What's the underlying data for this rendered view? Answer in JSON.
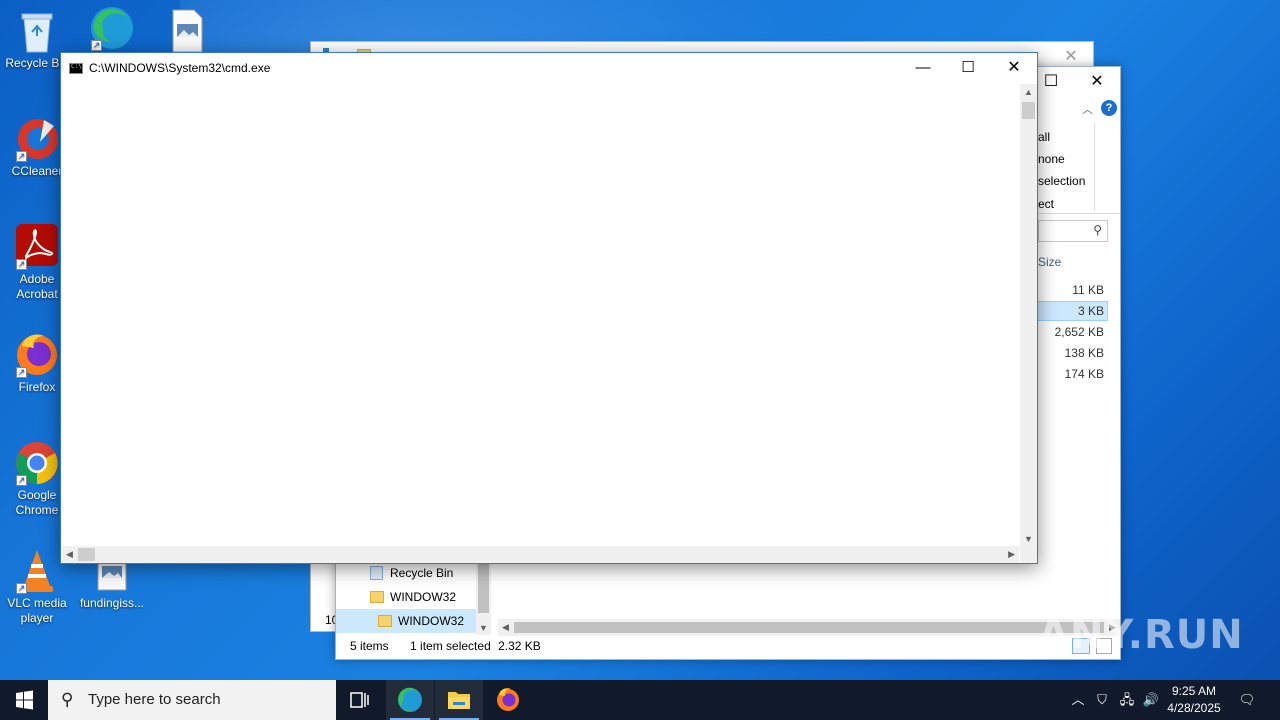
{
  "desktop": {
    "icons": [
      {
        "label": "Recycle Bin"
      },
      {
        "label": "CCleaner"
      },
      {
        "label": "Adobe Acrobat"
      },
      {
        "label": "Firefox"
      },
      {
        "label": "Google Chrome"
      },
      {
        "label": "VLC media player"
      },
      {
        "label": "fundingiss..."
      }
    ]
  },
  "explorer": {
    "ribbon": [
      "all",
      "none",
      "selection",
      "ect"
    ],
    "column_size": "Size",
    "sizes": [
      "11 KB",
      "3 KB",
      "2,652 KB",
      "138 KB",
      "174 KB"
    ],
    "nav": [
      "Recycle Bin",
      "WINDOW32",
      "WINDOW32"
    ],
    "back_row_fragment": "10",
    "status": {
      "items": "5 items",
      "selected": "1 item selected",
      "size": "2.32 KB"
    }
  },
  "cmd": {
    "title": "C:\\WINDOWS\\System32\\cmd.exe"
  },
  "taskbar": {
    "search_placeholder": "Type here to search",
    "time": "9:25 AM",
    "date": "4/28/2025"
  },
  "watermark": "ANY.RUN",
  "colors": {
    "desktop": "#1676d8",
    "taskbar": "#101a2a",
    "selection": "#cce8ff",
    "cmd_border": "#3a78c8"
  }
}
